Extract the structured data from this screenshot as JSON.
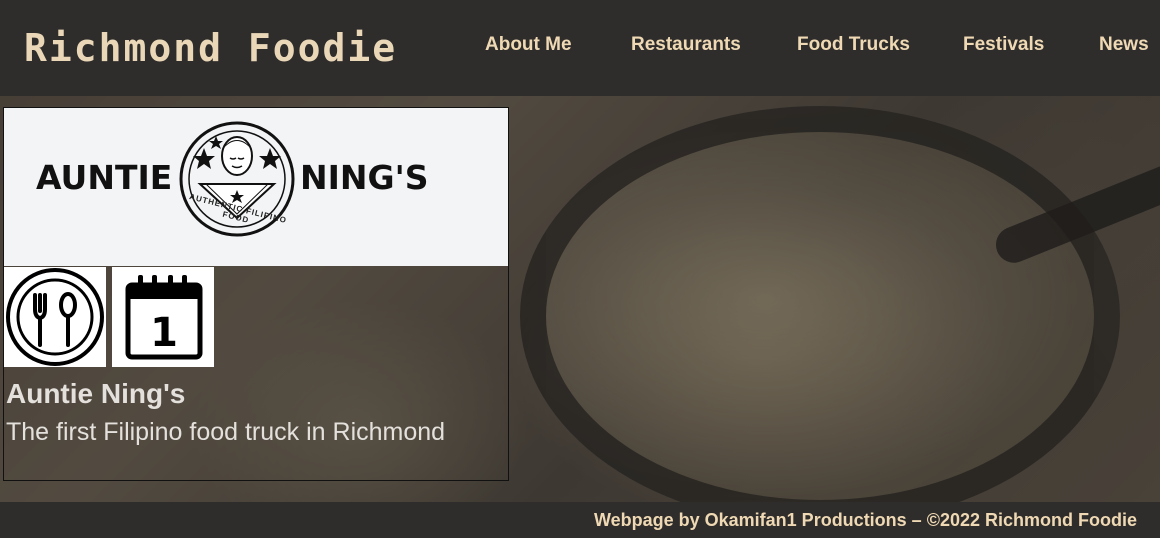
{
  "site": {
    "title": "Richmond Foodie"
  },
  "nav": {
    "items": [
      {
        "label": "About Me"
      },
      {
        "label": "Restaurants"
      },
      {
        "label": "Food Trucks"
      },
      {
        "label": "Festivals"
      },
      {
        "label": "News"
      }
    ]
  },
  "card": {
    "logo": {
      "left_word": "AUNTIE",
      "right_word": "NING'S",
      "tagline": "AUTHENTIC FILIPINO FOOD"
    },
    "name": "Auntie Ning's",
    "description": "The first Filipino food truck in Richmond",
    "calendar_day": "1",
    "icons": [
      "fork-spoon-plate-icon",
      "calendar-icon"
    ]
  },
  "footer": {
    "text": "Webpage by Okamifan1 Productions – ©2022 Richmond Foodie"
  },
  "colors": {
    "header_bg": "#2f2d2b",
    "nav_text": "#efd9b4",
    "logo_bg": "#f3f4f6"
  }
}
